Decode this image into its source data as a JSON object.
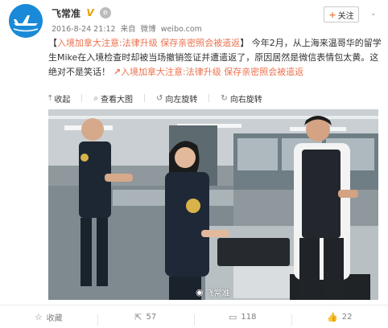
{
  "header": {
    "username": "飞常准",
    "verified_mark": "V",
    "badge": "ʚ",
    "timestamp": "2016-8-24 21:12",
    "source_prefix": "来自",
    "source_name": "微博",
    "source_url": "weibo.com",
    "follow_label": "+关注",
    "follow_plus": "+",
    "follow_text": "关注"
  },
  "post": {
    "prefix": "【",
    "headline": "入境加拿大注意:法律升级 保存亲密照会被遣返",
    "suffix": "】",
    "body": "    今年2月，从上海来温哥华的留学生Mike在入境检查时却被当场撤销签证并遭遣返了，原因居然是微信表情包太黄。这绝对不是笑话！",
    "link_icon": "🔗",
    "link_text": "入境加拿大注意:法律升级 保存亲密照会被遣返"
  },
  "picture_toolbar": {
    "collapse": "收起",
    "view_large": "查看大图",
    "rotate_left": "向左旋转",
    "rotate_right": "向右旋转"
  },
  "photo": {
    "watermark_text": "飞常准",
    "watermark_icon": "weibo-logo-icon"
  },
  "footer": {
    "favorite_label": "收藏",
    "repost_count": "57",
    "comment_count": "118",
    "like_count": "22"
  },
  "colors": {
    "link": "#eb7350",
    "avatar_bg": "#1a8ad8",
    "verified": "#e8a000"
  }
}
